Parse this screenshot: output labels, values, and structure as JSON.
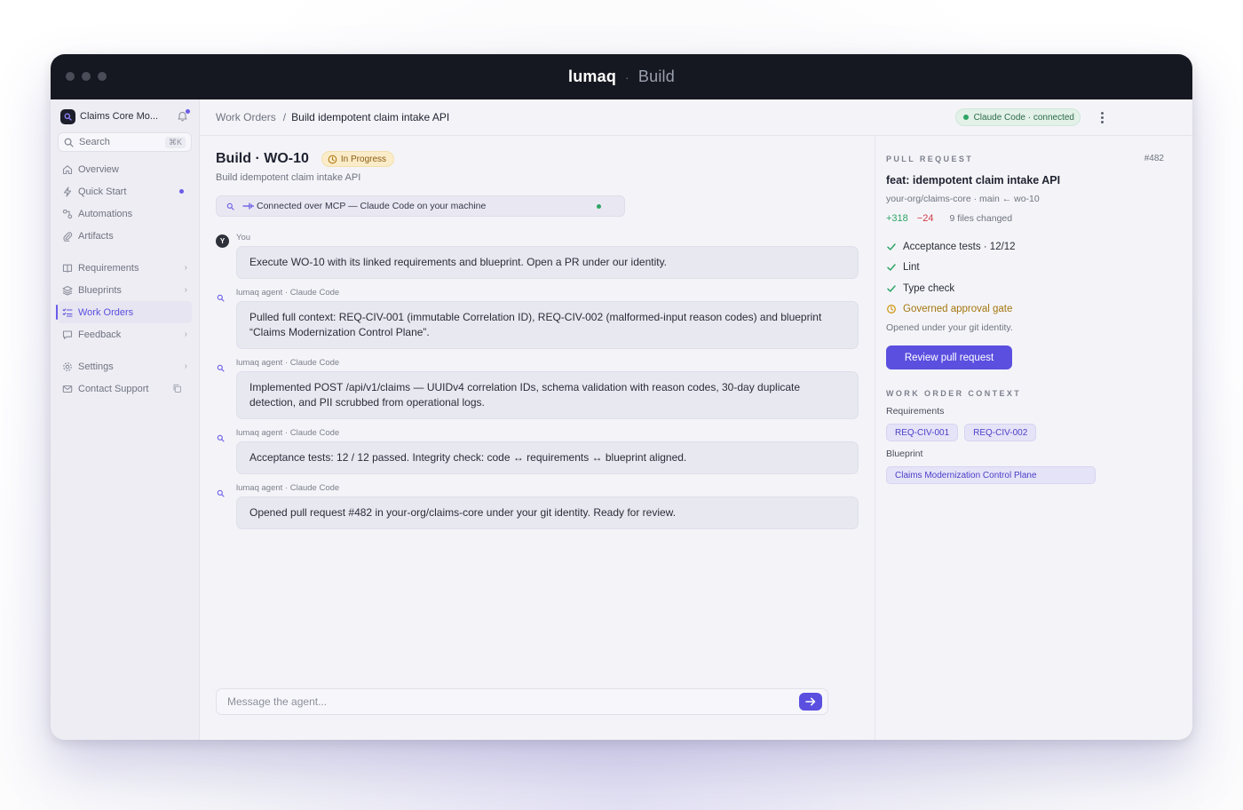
{
  "app": {
    "brand": "lumaq",
    "separator": "·",
    "mode": "Build"
  },
  "sidebar": {
    "workspace": "Claims Core Mo...",
    "search": {
      "label": "Search",
      "shortcut": "⌘K"
    },
    "items": [
      {
        "label": "Overview",
        "icon": "home-icon"
      },
      {
        "label": "Quick Start",
        "icon": "bolt-icon"
      },
      {
        "label": "Automations",
        "icon": "automation-icon"
      },
      {
        "label": "Artifacts",
        "icon": "paperclip-icon"
      },
      {
        "label": "Requirements",
        "icon": "book-icon"
      },
      {
        "label": "Blueprints",
        "icon": "layers-icon"
      },
      {
        "label": "Work Orders",
        "icon": "list-check-icon"
      },
      {
        "label": "Feedback",
        "icon": "chat-icon"
      },
      {
        "label": "Settings",
        "icon": "gear-icon"
      },
      {
        "label": "Contact Support",
        "icon": "mail-icon"
      }
    ]
  },
  "topbar": {
    "breadcrumb_parent": "Work Orders",
    "breadcrumb_sep": "/",
    "breadcrumb_current": "Build idempotent claim intake API",
    "connection_badge": "Claude Code · connected"
  },
  "work_order": {
    "title": "Build · WO-10",
    "status": "In Progress",
    "subtitle": "Build idempotent claim intake API",
    "mcp_text": "Connected over MCP — Claude Code on your machine"
  },
  "messages": [
    {
      "author": "You",
      "text": "Execute WO-10 with its linked requirements and blueprint. Open a PR under our identity."
    },
    {
      "author": "lumaq agent · Claude Code",
      "text": "Pulled full context: REQ-CIV-001 (immutable Correlation ID), REQ-CIV-002 (malformed-input reason codes) and blueprint “Claims Modernization Control Plane”."
    },
    {
      "author": "lumaq agent · Claude Code",
      "text": "Implemented POST /api/v1/claims — UUIDv4 correlation IDs, schema validation with reason codes, 30-day duplicate detection, and PII scrubbed from operational logs."
    },
    {
      "author": "lumaq agent · Claude Code",
      "text": "Acceptance tests: 12 / 12 passed. Integrity check: code ↔ requirements ↔ blueprint aligned."
    },
    {
      "author": "lumaq agent · Claude Code",
      "text": "Opened pull request #482 in your-org/claims-core under your git identity. Ready for review."
    }
  ],
  "composer": {
    "placeholder": "Message the agent..."
  },
  "pull_request": {
    "section_label": "PULL REQUEST",
    "number": "#482",
    "title": "feat: idempotent claim intake API",
    "meta": "your-org/claims-core · main ← wo-10",
    "additions": "+318",
    "deletions": "−24",
    "files_changed": "9 files changed",
    "checks": [
      {
        "label": "Acceptance tests · 12/12",
        "state": "pass"
      },
      {
        "label": "Lint",
        "state": "pass"
      },
      {
        "label": "Type check",
        "state": "pass"
      },
      {
        "label": "Governed approval gate",
        "state": "pending"
      }
    ],
    "note": "Opened under your git identity.",
    "review_button": "Review pull request"
  },
  "context": {
    "section_label": "WORK ORDER CONTEXT",
    "requirements_label": "Requirements",
    "requirements": [
      "REQ-CIV-001",
      "REQ-CIV-002"
    ],
    "blueprint_label": "Blueprint",
    "blueprint": "Claims Modernization Control Plane"
  },
  "colors": {
    "accent": "#5b4fe0",
    "success": "#2fa465",
    "danger": "#d23b45",
    "warning": "#a4760f",
    "titlebar": "#161821"
  }
}
